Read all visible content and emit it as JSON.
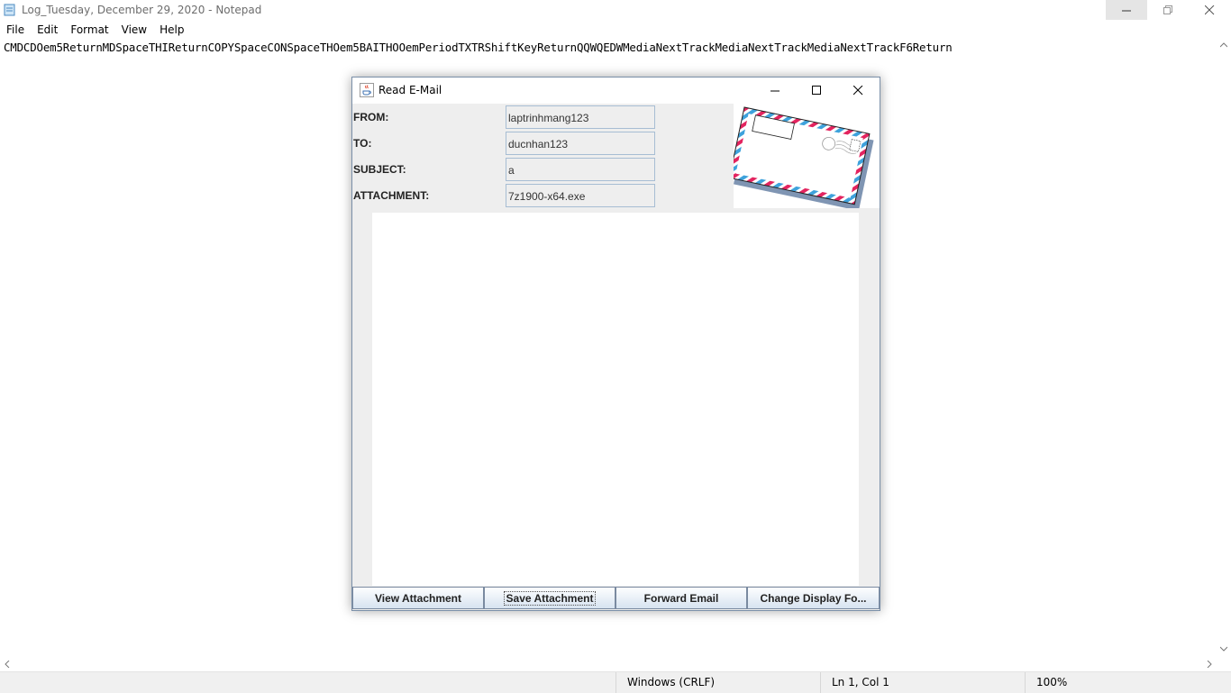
{
  "notepad": {
    "title": "Log_Tuesday, December 29, 2020 - Notepad",
    "menu": [
      "File",
      "Edit",
      "Format",
      "View",
      "Help"
    ],
    "content": "CMDCDOem5ReturnMDSpaceTHIReturnCOPYSpaceCONSpaceTHOem5BAITHOOemPeriodTXTRShiftKeyReturnQQWQEDWMediaNextTrackMediaNextTrackMediaNextTrackF6Return",
    "status": {
      "line_ending": "Windows (CRLF)",
      "position": "Ln 1, Col 1",
      "zoom": "100%"
    },
    "icons": [
      "notepad-icon",
      "minimize-icon",
      "restore-icon",
      "close-icon",
      "chevron-up-icon",
      "chevron-down-icon",
      "chevron-left-icon",
      "chevron-right-icon"
    ]
  },
  "dialog": {
    "title": "Read E-Mail",
    "fields": [
      {
        "label": "FROM:",
        "value": "laptrinhmang123"
      },
      {
        "label": "TO:",
        "value": "ducnhan123"
      },
      {
        "label": "SUBJECT:",
        "value": "a"
      },
      {
        "label": "ATTACHMENT:",
        "value": "7z1900-x64.exe"
      }
    ],
    "buttons": [
      "View Attachment",
      "Save Attachment",
      "Forward Email",
      "Change Display Fo..."
    ],
    "icons": [
      "java-cup-icon",
      "minimize-icon",
      "maximize-icon",
      "close-icon",
      "envelope-image"
    ],
    "colors": {
      "airmail_red": "#e3245f",
      "airmail_blue": "#3ea2dc",
      "button_border": "#7a8aa0"
    }
  }
}
